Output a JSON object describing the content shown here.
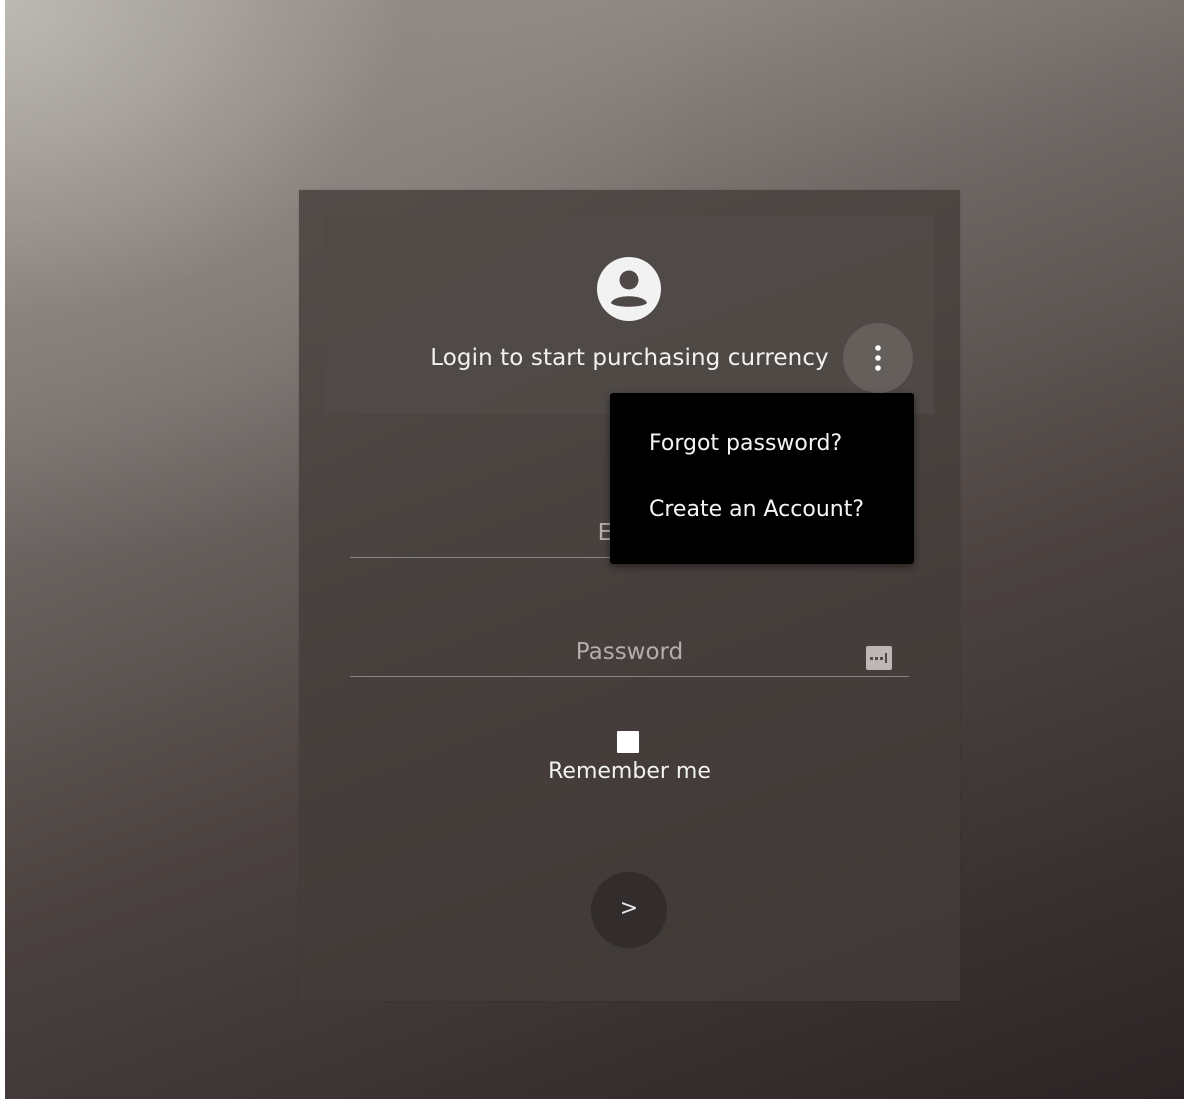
{
  "login": {
    "title": "Login to start purchasing currency",
    "email_placeholder": "Email",
    "password_placeholder": "Password",
    "remember_label": "Remember me",
    "submit_label": ">"
  },
  "menu": {
    "items": [
      {
        "label": "Forgot password?"
      },
      {
        "label": "Create an Account?"
      }
    ]
  },
  "icons": {
    "avatar": "account-circle-icon",
    "more": "more-vert-icon",
    "password": "password-key-icon"
  }
}
